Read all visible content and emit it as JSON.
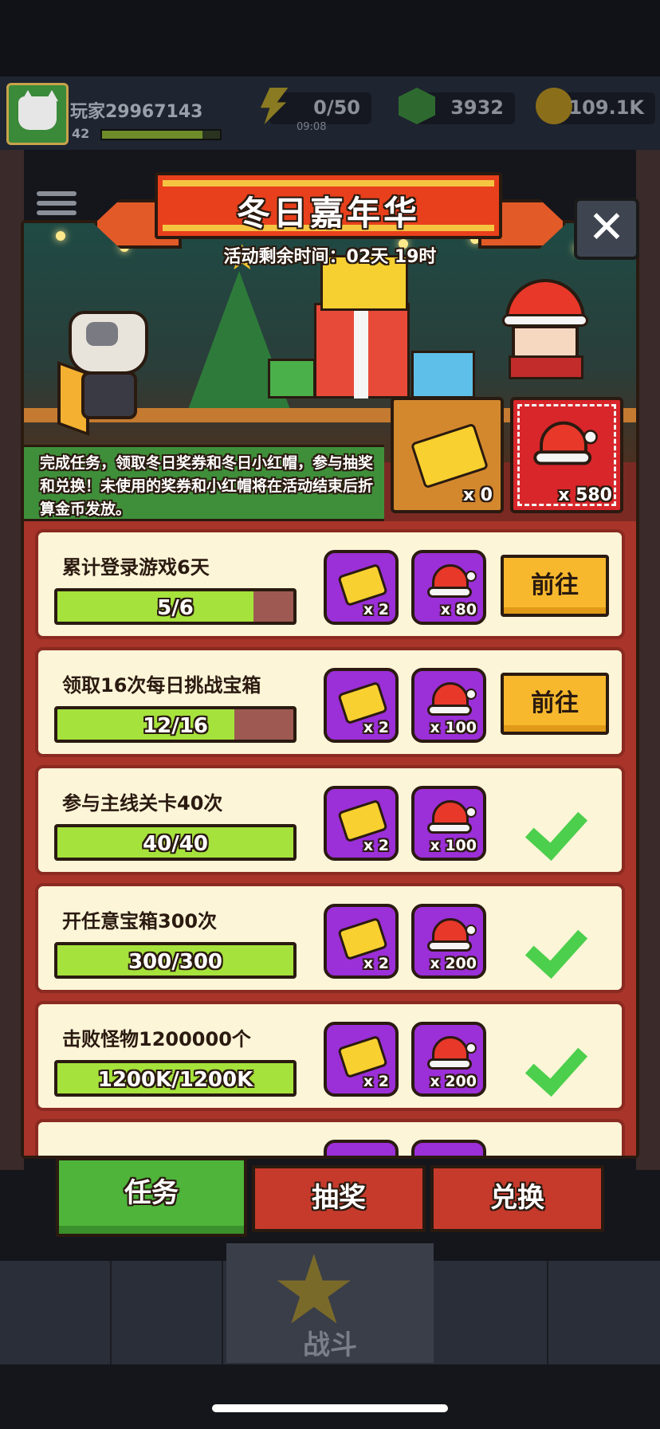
{
  "player": {
    "name": "玩家29967143",
    "level": "42"
  },
  "resources": {
    "energy": "0/50",
    "energy_timer": "09:08",
    "gems": "3932",
    "coins": "109.1K"
  },
  "event": {
    "title": "冬日嘉年华",
    "remaining_time": "活动剩余时间：02天 19时",
    "close_label": "✕",
    "description": "完成任务，领取冬日奖券和冬日小红帽，参与抽奖和兑换！未使用的奖券和小红帽将在活动结束后折算金币发放。",
    "ticket_count": "x 0",
    "hat_count": "x 580"
  },
  "tasks": [
    {
      "name": "累计登录游戏6天",
      "progress": "5/6",
      "fraction": 0.83,
      "ticket_reward": "x 2",
      "hat_reward": "x 80",
      "action": "前往",
      "completed": false
    },
    {
      "name": "领取16次每日挑战宝箱",
      "progress": "12/16",
      "fraction": 0.75,
      "ticket_reward": "x 2",
      "hat_reward": "x 100",
      "action": "前往",
      "completed": false
    },
    {
      "name": "参与主线关卡40次",
      "progress": "40/40",
      "fraction": 1.0,
      "ticket_reward": "x 2",
      "hat_reward": "x 100",
      "action": "",
      "completed": true
    },
    {
      "name": "开任意宝箱300次",
      "progress": "300/300",
      "fraction": 1.0,
      "ticket_reward": "x 2",
      "hat_reward": "x 200",
      "action": "",
      "completed": true
    },
    {
      "name": "击败怪物1200000个",
      "progress": "1200K/1200K",
      "fraction": 1.0,
      "ticket_reward": "x 2",
      "hat_reward": "x 200",
      "action": "",
      "completed": true
    }
  ],
  "tabs": {
    "tasks": "任务",
    "lottery": "抽奖",
    "exchange": "兑换"
  },
  "nav": {
    "battle": "战斗"
  },
  "colors": {
    "progress_fill": "#a6e23c",
    "reward_purple": "#9b2fd8",
    "go_button": "#f7b82e",
    "active_tab": "#4fb43a"
  }
}
